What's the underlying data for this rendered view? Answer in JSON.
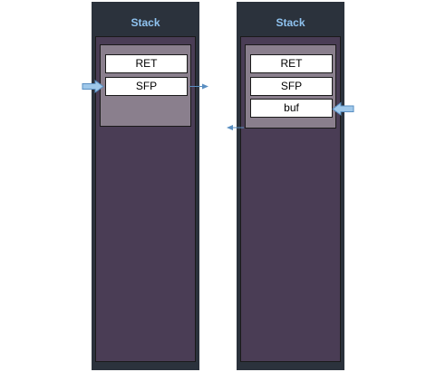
{
  "columns": [
    {
      "title": "Stack",
      "cells": [
        "RET",
        "SFP"
      ]
    },
    {
      "title": "Stack",
      "cells": [
        "RET",
        "SFP",
        "buf"
      ]
    }
  ],
  "colors": {
    "column_bg": "#2b323c",
    "stack_bg": "#4a3d55",
    "frame_bg": "#8a7f8d",
    "title_text": "#8fc3f0",
    "arrow_fill": "#9fc8ea",
    "arrow_stroke": "#5a8fc2"
  }
}
